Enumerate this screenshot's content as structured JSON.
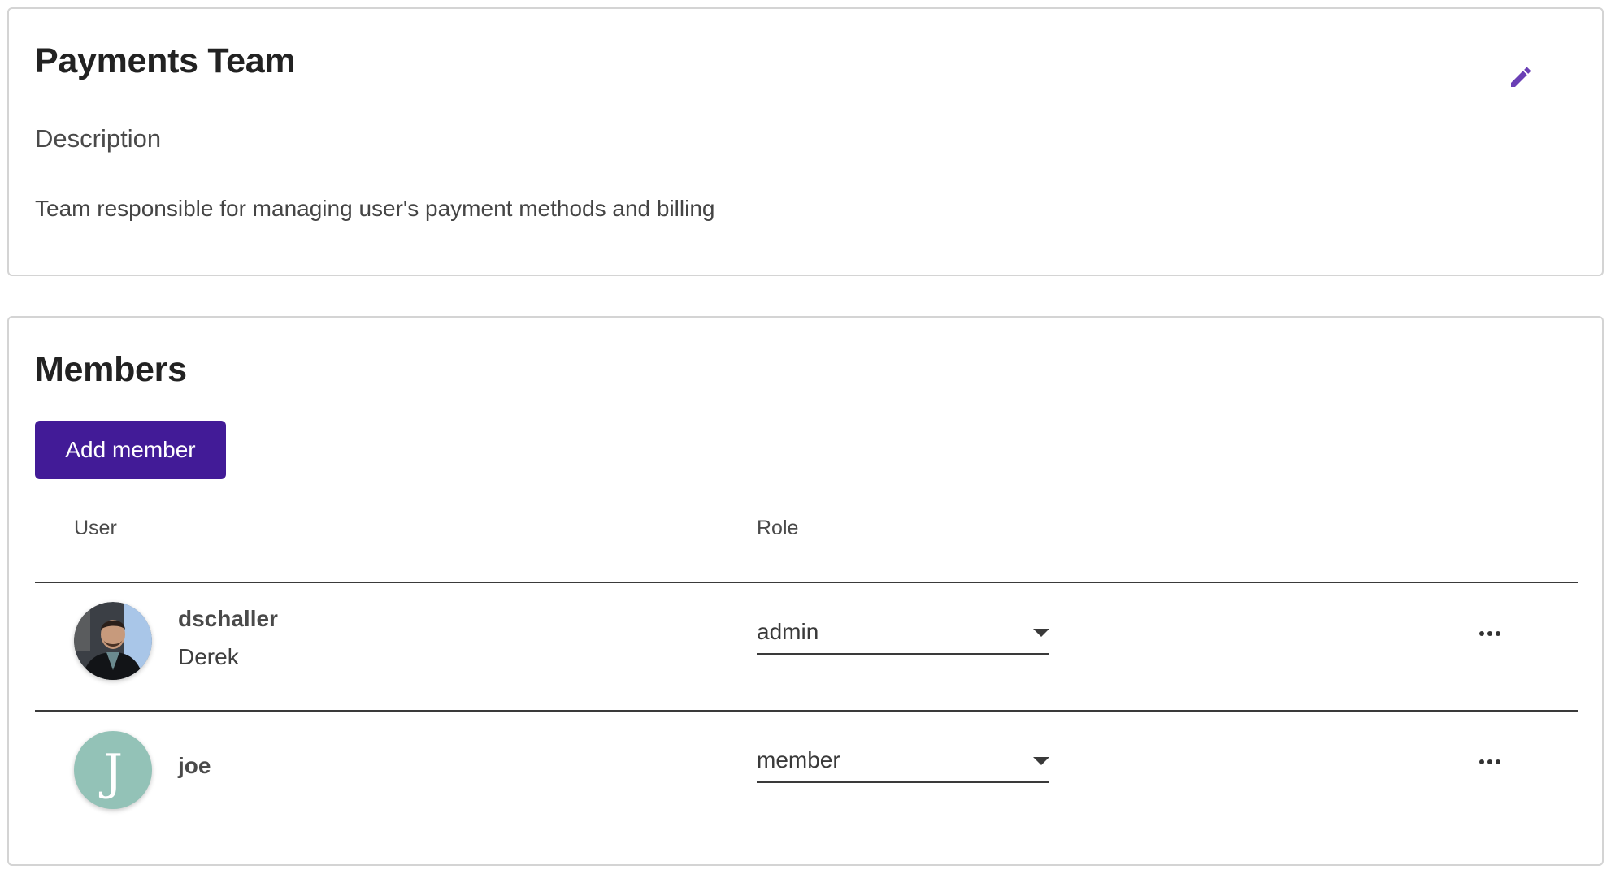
{
  "team": {
    "title": "Payments Team",
    "description_label": "Description",
    "description": "Team responsible for managing user's payment methods and billing",
    "edit_icon": "pencil-icon"
  },
  "members": {
    "title": "Members",
    "add_button_label": "Add member",
    "columns": {
      "user": "User",
      "role": "Role"
    },
    "rows": [
      {
        "username": "dschaller",
        "full_name": "Derek",
        "role": "admin",
        "avatar": "photo",
        "more_icon": "more-horizontal-icon"
      },
      {
        "username": "joe",
        "full_name": "",
        "role": "member",
        "avatar_letter": "J",
        "avatar_color": "#93c2b7",
        "more_icon": "more-horizontal-icon"
      }
    ]
  },
  "colors": {
    "accent": "#421b97",
    "edit_icon": "#6a3fb5",
    "border": "#d4d4d4",
    "divider": "#3a3a3a"
  }
}
